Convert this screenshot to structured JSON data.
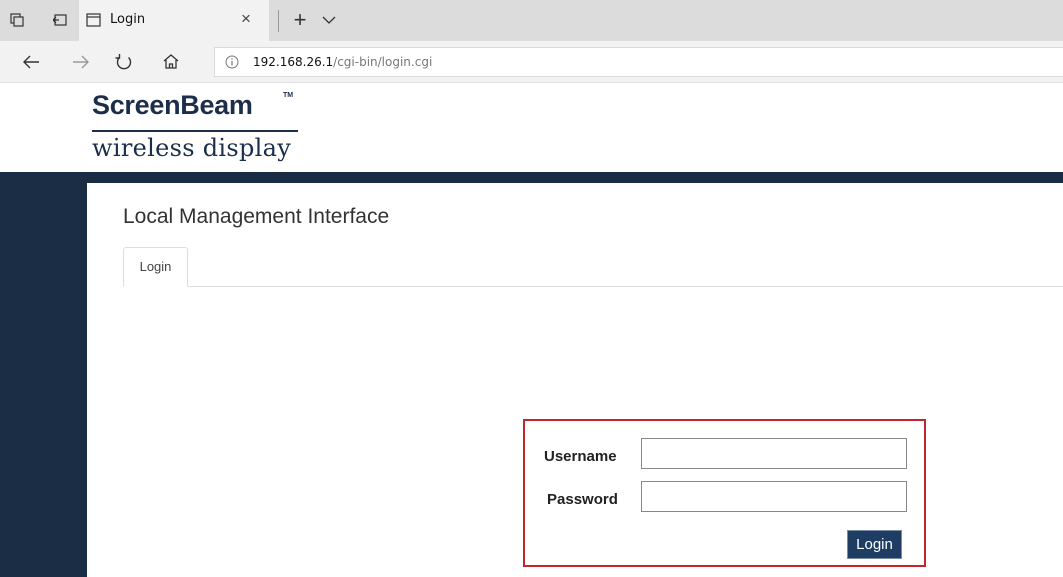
{
  "browser": {
    "tab": {
      "title": "Login",
      "close_glyph": "×"
    },
    "new_tab_glyph": "+",
    "address": {
      "host": "192.168.26.1",
      "path": "/cgi-bin/login.cgi"
    },
    "icons": [
      "tab-preview-icon",
      "set-tabs-aside-icon",
      "page-favicon-icon",
      "chevron-down-icon",
      "back-arrow-icon",
      "forward-arrow-icon",
      "refresh-icon",
      "home-icon",
      "info-icon"
    ]
  },
  "header": {
    "brand": "ScreenBeam",
    "trademark": "TM",
    "tagline": "wireless display"
  },
  "main": {
    "title": "Local Management Interface",
    "tabs": [
      {
        "label": "Login"
      }
    ]
  },
  "login_form": {
    "username_label": "Username",
    "password_label": "Password",
    "username_value": "",
    "password_value": "",
    "submit_label": "Login"
  },
  "colors": {
    "brand_navy": "#1c2e4a",
    "band_navy": "#1b2c45",
    "button_blue": "#1f3d63",
    "highlight_red": "#c0272d"
  }
}
